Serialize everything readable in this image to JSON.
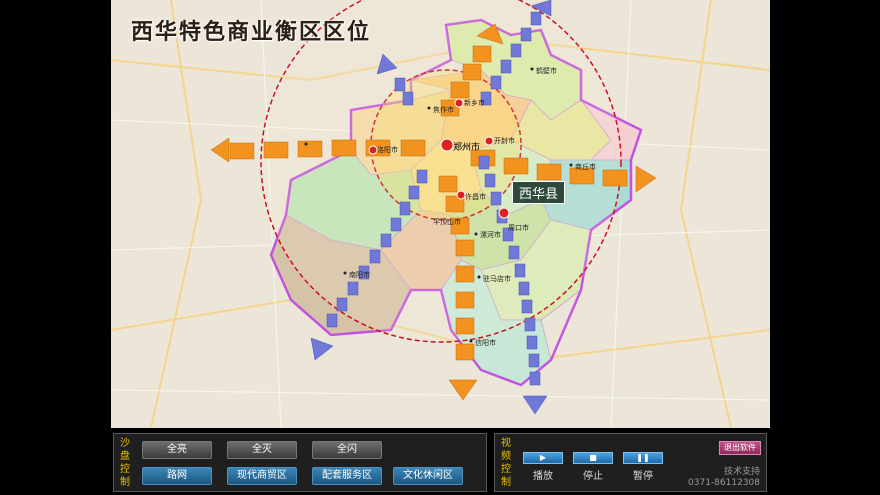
{
  "map": {
    "title": "西华特色商业衡区区位",
    "county_label": "西华县",
    "cities": [
      "郑州市",
      "新乡市",
      "开封市",
      "洛阳市",
      "许昌市",
      "漯河市",
      "周口市",
      "平顶山市",
      "商丘市",
      "南阳市",
      "驻马店市",
      "信阳市",
      "焦作市",
      "鹤壁市"
    ]
  },
  "left_panel": {
    "title_chars": [
      "沙",
      "盘",
      "控",
      "制"
    ],
    "row1": [
      "全亮",
      "全灭",
      "全闪"
    ],
    "row2": [
      "路网",
      "现代商贸区",
      "配套服务区",
      "文化休闲区"
    ]
  },
  "right_panel": {
    "title_chars": [
      "视",
      "频",
      "控",
      "制"
    ],
    "exit_label": "退出软件",
    "media": [
      {
        "icon": "play-icon",
        "label": "播放"
      },
      {
        "icon": "stop-icon",
        "label": "停止"
      },
      {
        "icon": "pause-icon",
        "label": "暂停"
      }
    ],
    "support_name": "技术支持",
    "support_phone": "0371-86112308"
  }
}
